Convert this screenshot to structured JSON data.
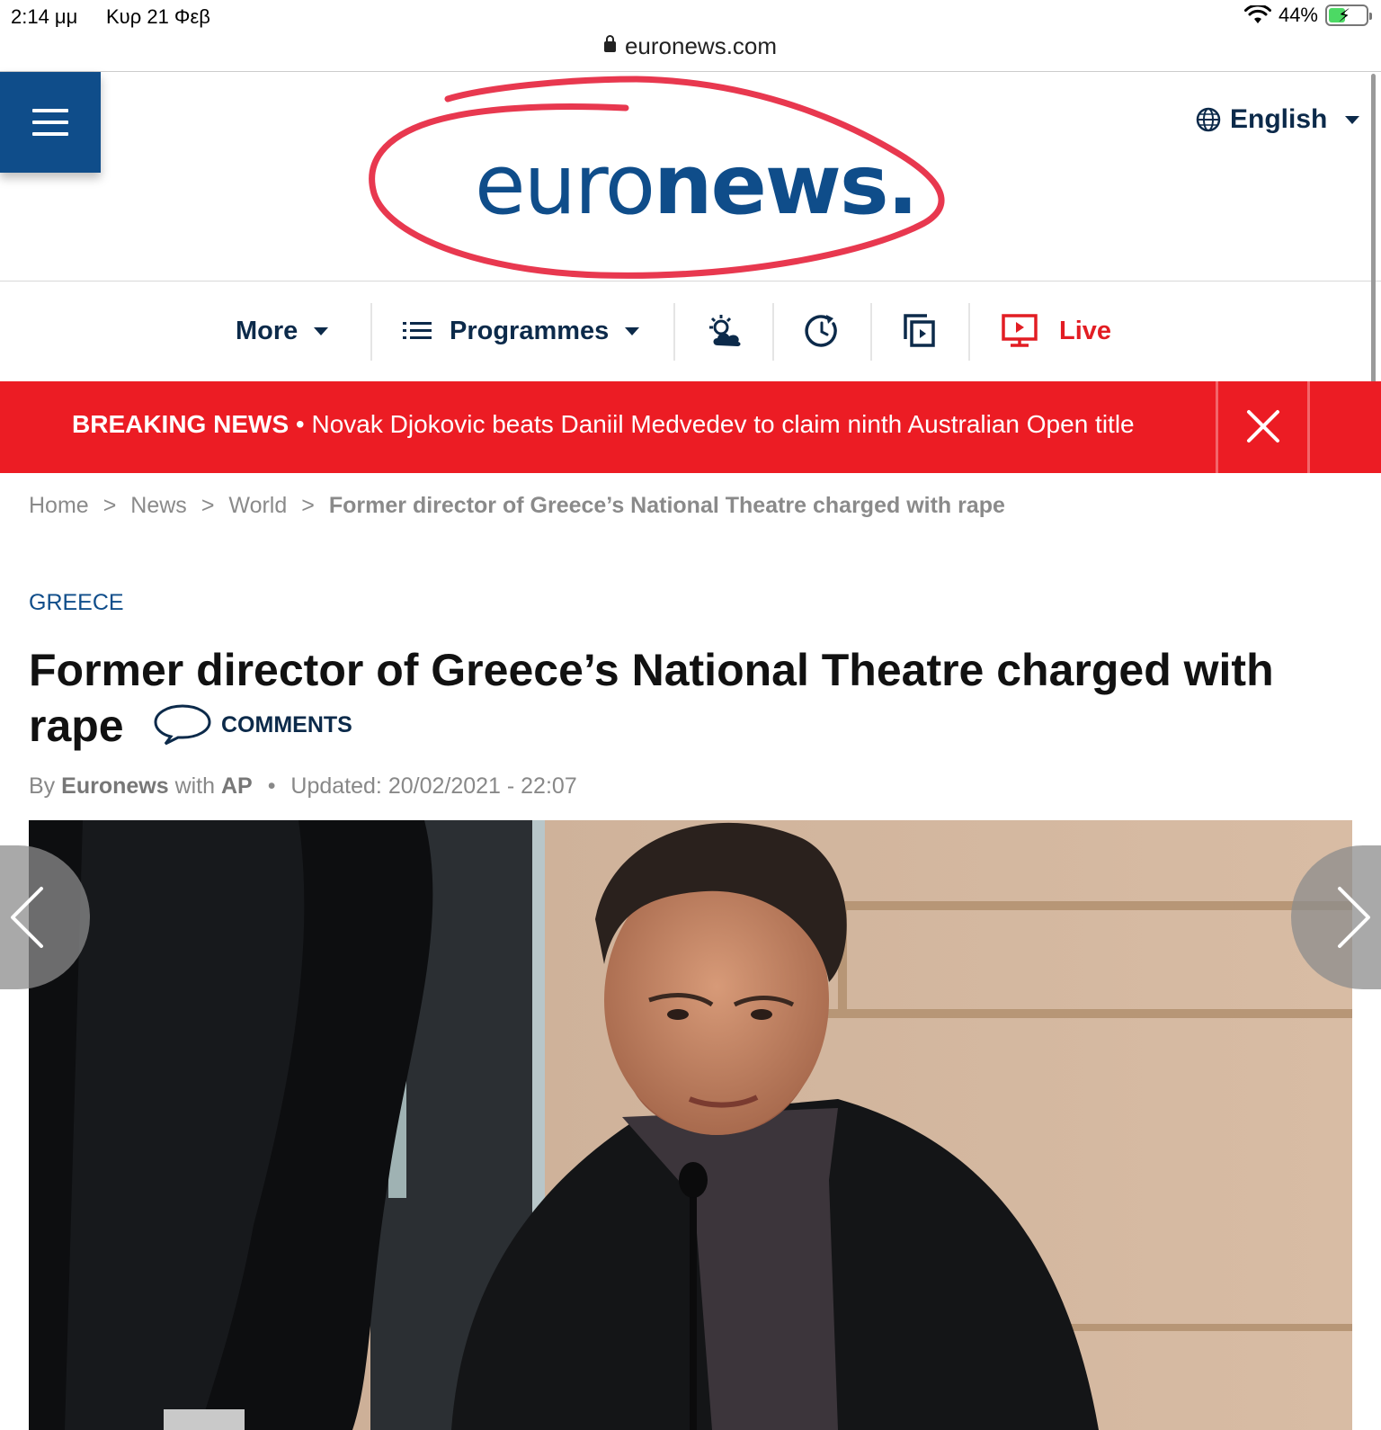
{
  "status_bar": {
    "time": "2:14 μμ",
    "date": "Κυρ 21 Φεβ",
    "battery_percent": "44%",
    "battery_level": 0.44
  },
  "browser": {
    "url": "euronews.com"
  },
  "header": {
    "logo": {
      "thin": "euro",
      "bold": "news."
    },
    "language": "English",
    "annotation_color": "#e8384f",
    "brand_color": "#0f4d8a"
  },
  "nav": {
    "more": "More",
    "programmes": "Programmes",
    "live": "Live",
    "icons": [
      "weather-icon",
      "clock-icon",
      "copy-icon"
    ]
  },
  "breaking": {
    "label": "BREAKING NEWS",
    "bullet": "•",
    "text": "Novak Djokovic beats Daniil Medvedev to claim ninth Australian Open title",
    "color": "#ec1c24"
  },
  "breadcrumb": {
    "items": [
      "Home",
      "News",
      "World"
    ],
    "separator": ">",
    "current": "Former director of Greece’s National Theatre charged with rape"
  },
  "article": {
    "kicker": "GREECE",
    "title": "Former director of Greece’s National Theatre charged with rape",
    "comments_label": "COMMENTS",
    "byline": {
      "by": "By",
      "author": "Euronews",
      "with": "with",
      "agency": "AP",
      "dot": "•",
      "updated": "Updated: 20/02/2021 - 22:07"
    }
  }
}
